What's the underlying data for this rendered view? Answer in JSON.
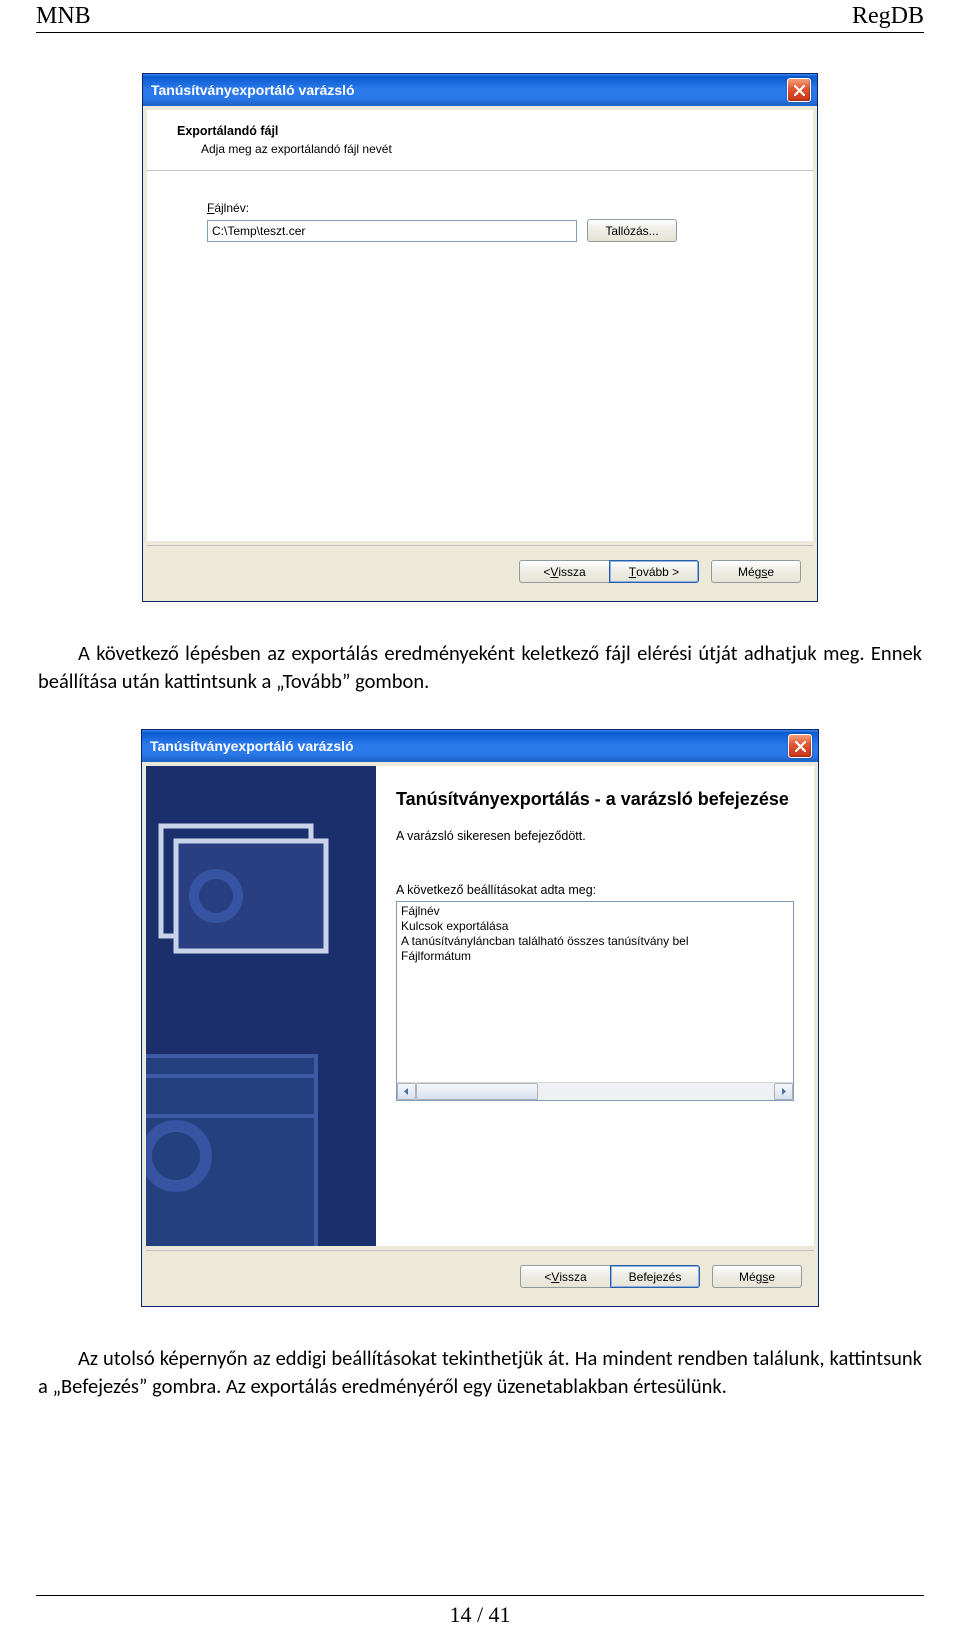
{
  "doc": {
    "header_left": "MNB",
    "header_right": "RegDB",
    "page_number": "14 / 41",
    "para1": "A következő lépésben az exportálás eredményeként keletkező fájl elérési útját adhatjuk meg. Ennek beállítása után kattintsunk a „Tovább” gombon.",
    "para2": "Az utolsó képernyőn az eddigi beállításokat tekinthetjük át. Ha mindent rendben találunk, kattintsunk a „Befejezés” gombra. Az exportálás eredményéről egy üzenetablakban értesülünk."
  },
  "dlg1": {
    "title": "Tanúsítványexportáló varázsló",
    "heading": "Exportálandó fájl",
    "subheading": "Adja meg az exportálandó fájl nevét",
    "file_label_pre": "F",
    "file_label_post": "ájlnév:",
    "file_value": "C:\\Temp\\teszt.cer",
    "browse": "Tallózás...",
    "back_pre": "< ",
    "back_u": "V",
    "back_post": "issza",
    "next_u": "T",
    "next_post": "ovább >",
    "cancel_pre": "Még",
    "cancel_u": "s",
    "cancel_post": "e"
  },
  "dlg2": {
    "title": "Tanúsítványexportáló varázsló",
    "heading": "Tanúsítványexportálás - a varázsló befejezése",
    "done_msg": "A varázsló sikeresen befejeződött.",
    "list_label": "A következő beállításokat adta meg:",
    "rows": [
      "Fájlnév",
      "Kulcsok exportálása",
      "A tanúsítványláncban található összes tanúsítvány bel",
      "Fájlformátum"
    ],
    "back_pre": "< ",
    "back_u": "V",
    "back_post": "issza",
    "finish": "Befejezés",
    "cancel_pre": "Még",
    "cancel_u": "s",
    "cancel_post": "e"
  }
}
